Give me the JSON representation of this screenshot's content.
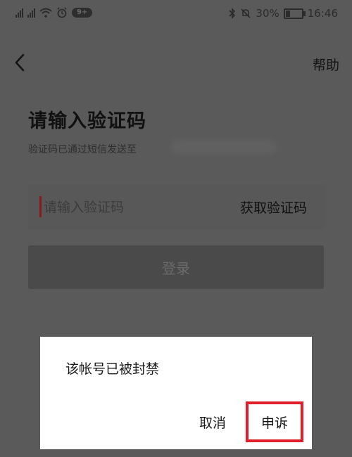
{
  "status_bar": {
    "signal_1_tag": "4G",
    "signal_2_tag": "4G",
    "notification_badge": "9+",
    "battery_percent": "30%",
    "battery_level": 0.3,
    "time": "16:46"
  },
  "nav": {
    "back_icon": "chevron-left-icon",
    "help_label": "帮助"
  },
  "form": {
    "title": "请输入验证码",
    "subtitle": "验证码已通过短信发送至",
    "code_placeholder": "请输入验证码",
    "code_value": "",
    "get_code_label": "获取验证码",
    "login_label": "登录"
  },
  "dialog": {
    "message": "该帐号已被封禁",
    "cancel_label": "取消",
    "appeal_label": "申诉",
    "highlight_color": "#e01f2b"
  },
  "colors": {
    "overlay": "#5a5a5a",
    "dialog_bg": "#ffffff"
  }
}
